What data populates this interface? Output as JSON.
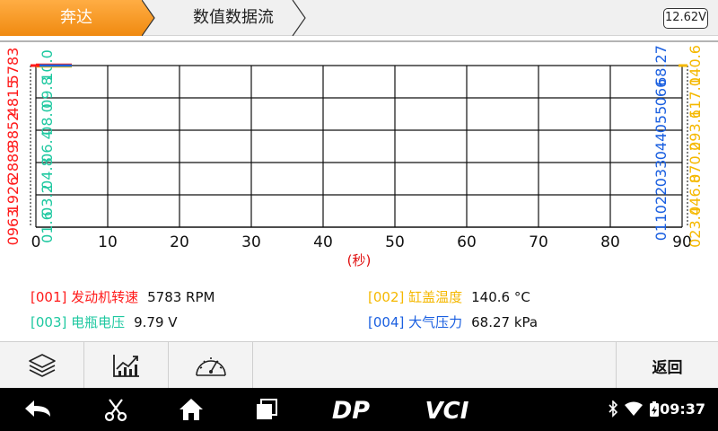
{
  "header": {
    "brand": "奔达",
    "page_title": "数值数据流",
    "battery_voltage": "12.62V",
    "colors": {
      "brand_tab": "#f7931e"
    }
  },
  "chart_data": {
    "type": "line",
    "x_ticks": [
      0,
      10,
      20,
      30,
      40,
      50,
      60,
      70,
      80,
      90
    ],
    "xlim": [
      0,
      90
    ],
    "xlabel": "(秒)",
    "grid": true,
    "left_axes": [
      {
        "color": "#ff1a1a",
        "labels": [
          "0963",
          "1926",
          "2889",
          "3852",
          "4815",
          "5783"
        ]
      },
      {
        "color": "#1ec8a0",
        "labels": [
          "01.6",
          "03.2",
          "04.8",
          "06.4",
          "08.0",
          "09.8",
          "10.0"
        ]
      }
    ],
    "right_axes": [
      {
        "color": "#1a5fe0",
        "labels": [
          "011",
          "022",
          "033",
          "044",
          "055",
          "066",
          "68.27"
        ]
      },
      {
        "color": "#f5b800",
        "labels": [
          "023.4",
          "046.8",
          "070.2",
          "093.6",
          "117.0",
          "140.6"
        ]
      }
    ],
    "series": [
      {
        "name": "[001] 发动机转速",
        "color": "#ff1a1a",
        "x": [
          0,
          5
        ],
        "y": [
          5783,
          5783
        ]
      },
      {
        "name": "[002] 缸盖温度",
        "color": "#f5b800",
        "x": [
          0,
          5
        ],
        "y": [
          140.6,
          140.6
        ]
      },
      {
        "name": "[003] 电瓶电压",
        "color": "#1ec8a0",
        "x": [
          0,
          5
        ],
        "y": [
          9.79,
          9.79
        ]
      },
      {
        "name": "[004] 大气压力",
        "color": "#1a5fe0",
        "x": [
          0,
          5
        ],
        "y": [
          68.27,
          68.27
        ]
      }
    ]
  },
  "legend": [
    {
      "name": "[001] 发动机转速",
      "value": "5783 RPM",
      "color": "#ff1a1a"
    },
    {
      "name": "[002] 缸盖温度",
      "value": "140.6 °C",
      "color": "#f5b800"
    },
    {
      "name": "[003] 电瓶电压",
      "value": "9.79 V",
      "color": "#1ec8a0"
    },
    {
      "name": "[004] 大气压力",
      "value": "68.27 kPa",
      "color": "#1a5fe0"
    }
  ],
  "toolbar": {
    "buttons": [
      {
        "icon": "layers-icon"
      },
      {
        "icon": "line-chart-icon"
      },
      {
        "icon": "gauge-icon"
      }
    ],
    "back_label": "返回"
  },
  "navbar": {
    "dp_label": "DP",
    "vci_label": "VCI",
    "time": "09:37"
  }
}
